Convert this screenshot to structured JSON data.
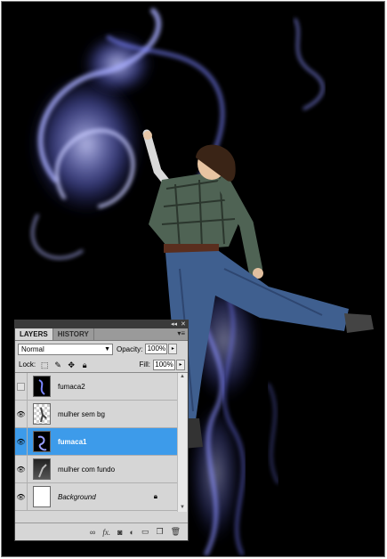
{
  "panel": {
    "top_controls": {
      "collapse_icon": "double-chevron-icon",
      "close_icon": "close-icon"
    },
    "tabs": [
      {
        "label": "LAYERS",
        "active": true
      },
      {
        "label": "HISTORY",
        "active": false
      }
    ],
    "menu_icon": "panel-menu-icon",
    "blend_mode": "Normal",
    "opacity_label": "Opacity:",
    "opacity_value": "100%",
    "lock_label": "Lock:",
    "fill_label": "Fill:",
    "fill_value": "100%",
    "layers": [
      {
        "name": "fumaca2",
        "visible": false,
        "selected": false
      },
      {
        "name": "mulher sem bg",
        "visible": true,
        "selected": false
      },
      {
        "name": "fumaca1",
        "visible": true,
        "selected": true
      },
      {
        "name": "mulher com fundo",
        "visible": true,
        "selected": false
      },
      {
        "name": "Background",
        "visible": true,
        "selected": false,
        "locked": true
      }
    ],
    "bottom_icons": [
      "link-icon",
      "fx-icon",
      "mask-icon",
      "adjustment-icon",
      "group-icon",
      "new-layer-icon",
      "trash-icon"
    ],
    "bottom_fx": "fx."
  },
  "colors": {
    "selection": "#3d9bea",
    "smoke": "#7a86ff",
    "background": "#000000"
  }
}
